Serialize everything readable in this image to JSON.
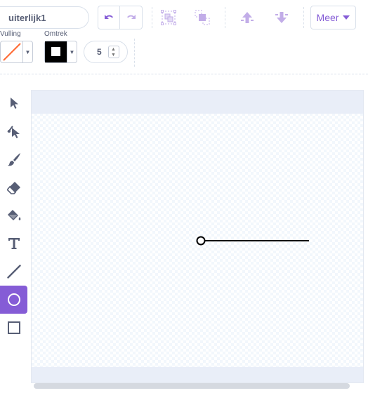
{
  "costume": {
    "name_value": "uiterlijk1"
  },
  "toolbar": {
    "undo_icon": "undo-icon",
    "redo_icon": "redo-icon",
    "group_icon": "group-icon",
    "ungroup_icon": "ungroup-icon",
    "forward_icon": "bring-forward-icon",
    "backward_icon": "send-backward-icon",
    "more_label": "Meer"
  },
  "fill": {
    "label": "Vulling",
    "color": "#ff6a33"
  },
  "outline": {
    "label": "Omtrek",
    "color": "#000000",
    "width_value": "5"
  },
  "colors": {
    "accent": "#855cd6",
    "accent_disabled": "#c2ade8"
  },
  "tools": [
    "select",
    "reshape",
    "brush",
    "eraser",
    "fill",
    "text",
    "line",
    "circle",
    "rectangle"
  ],
  "active_tool": "circle"
}
